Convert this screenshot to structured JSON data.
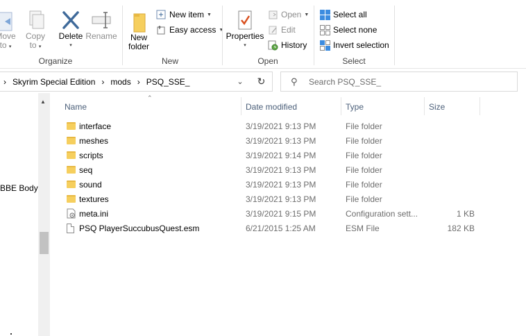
{
  "ribbon": {
    "organize": {
      "label": "Organize",
      "move_to": [
        "Move",
        "to"
      ],
      "copy_to": [
        "Copy",
        "to"
      ],
      "delete": "Delete",
      "rename": "Rename"
    },
    "new": {
      "label": "New",
      "new_folder": [
        "New",
        "folder"
      ],
      "new_item": "New item",
      "easy_access": "Easy access"
    },
    "open": {
      "label": "Open",
      "properties": "Properties",
      "open": "Open",
      "edit": "Edit",
      "history": "History"
    },
    "select": {
      "label": "Select",
      "select_all": "Select all",
      "select_none": "Select none",
      "invert_selection": "Invert selection"
    }
  },
  "address": {
    "crumbs": [
      "Skyrim Special Edition",
      "mods",
      "PSQ_SSE_"
    ]
  },
  "search": {
    "placeholder": "Search PSQ_SSE_"
  },
  "navpane": {
    "partial_item": "BBE BodySl"
  },
  "columns": {
    "name": "Name",
    "date": "Date modified",
    "type": "Type",
    "size": "Size"
  },
  "files": [
    {
      "name": "interface",
      "date": "3/19/2021 9:13 PM",
      "type": "File folder",
      "size": "",
      "icon": "folder-icon"
    },
    {
      "name": "meshes",
      "date": "3/19/2021 9:13 PM",
      "type": "File folder",
      "size": "",
      "icon": "folder-icon"
    },
    {
      "name": "scripts",
      "date": "3/19/2021 9:14 PM",
      "type": "File folder",
      "size": "",
      "icon": "folder-icon"
    },
    {
      "name": "seq",
      "date": "3/19/2021 9:13 PM",
      "type": "File folder",
      "size": "",
      "icon": "folder-icon"
    },
    {
      "name": "sound",
      "date": "3/19/2021 9:13 PM",
      "type": "File folder",
      "size": "",
      "icon": "folder-icon"
    },
    {
      "name": "textures",
      "date": "3/19/2021 9:13 PM",
      "type": "File folder",
      "size": "",
      "icon": "folder-icon"
    },
    {
      "name": "meta.ini",
      "date": "3/19/2021 9:15 PM",
      "type": "Configuration sett...",
      "size": "1 KB",
      "icon": "ini-file-icon"
    },
    {
      "name": "PSQ PlayerSuccubusQuest.esm",
      "date": "6/21/2015 1:25 AM",
      "type": "ESM File",
      "size": "182 KB",
      "icon": "file-icon"
    }
  ],
  "colors": {
    "header_text": "#4c607a",
    "folder": "#f6cf5e",
    "accent": "#1e6fd0"
  }
}
